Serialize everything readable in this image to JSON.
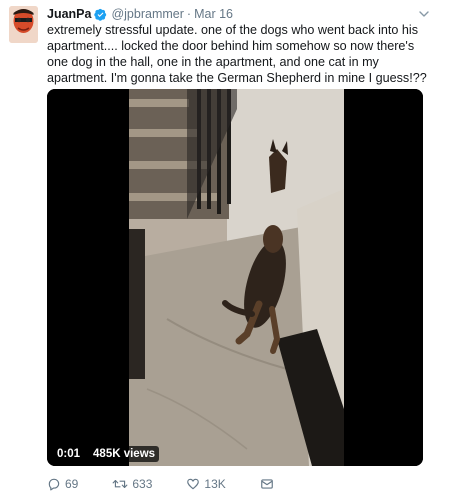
{
  "tweet": {
    "author_name": "JuanPa",
    "handle": "@jpbrammer",
    "separator": "·",
    "date": "Mar 16",
    "text": "extremely stressful update. one of the dogs who went back into his apartment.... locked the door behind him somehow so now there's one dog in the hall, one in the apartment, and one cat in my apartment. I'm gonna take the German Shepherd in mine I guess!??",
    "verified_color": "#1da1f2"
  },
  "video": {
    "timestamp": "0:01",
    "views": "485K views"
  },
  "actions": {
    "replies": "69",
    "retweets": "633",
    "likes": "13K"
  },
  "icons": [
    "avatar",
    "verified-icon",
    "chevron-down-icon",
    "reply-icon",
    "retweet-icon",
    "like-icon",
    "message-icon"
  ]
}
